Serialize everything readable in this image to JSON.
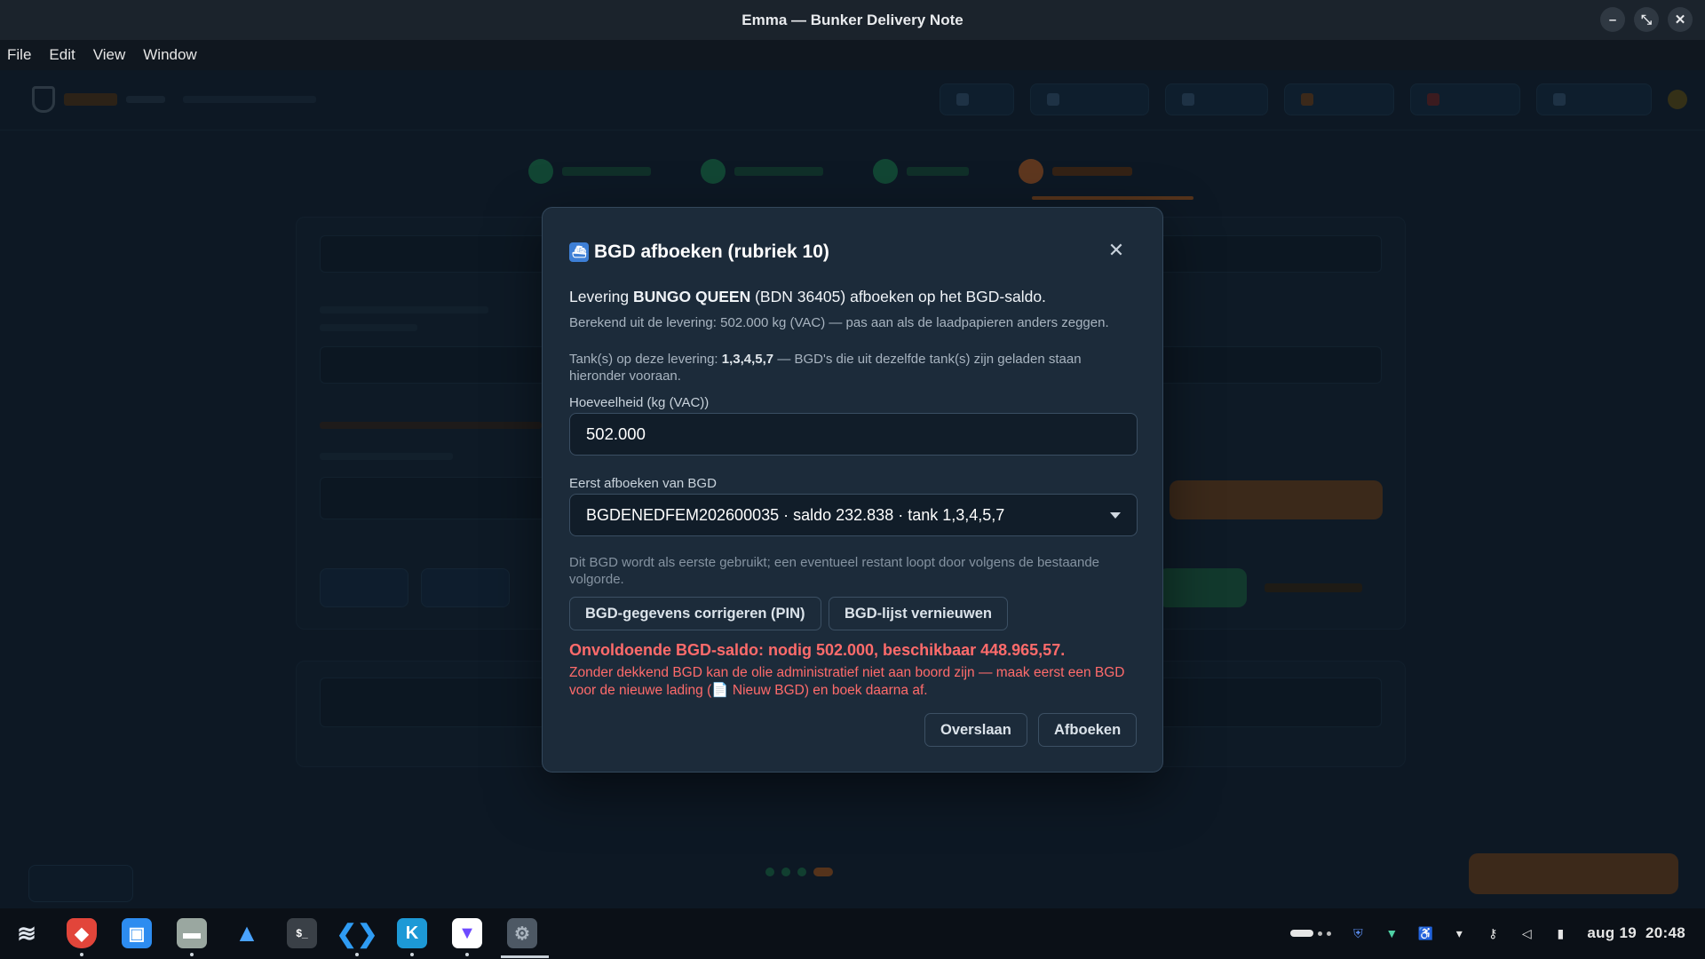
{
  "window": {
    "title": "Emma — Bunker Delivery Note"
  },
  "menu": [
    "File",
    "Edit",
    "View",
    "Window"
  ],
  "modal": {
    "title": "BGD afboeken (rubriek 10)",
    "lead_prefix": "Levering ",
    "lead_vessel": "BUNGO QUEEN",
    "lead_suffix": " (BDN 36405) afboeken op het BGD-saldo.",
    "note_calc": "Berekend uit de levering: 502.000 kg (VAC) — pas aan als de laadpapieren anders zeggen.",
    "note_tanks_prefix": "Tank(s) op deze levering: ",
    "note_tanks_value": "1,3,4,5,7",
    "note_tanks_suffix": " — BGD's die uit dezelfde tank(s) zijn geladen staan hieronder vooraan.",
    "quantity_label": "Hoeveelheid (kg (VAC))",
    "quantity_value": "502.000",
    "bgd_label": "Eerst afboeken van BGD",
    "bgd_selected": "BGDENEDFEM202600035 · saldo 232.838 · tank 1,3,4,5,7",
    "bgd_help": "Dit BGD wordt als eerste gebruikt; een eventueel restant loopt door volgens de bestaande volgorde.",
    "btn_correct": "BGD-gegevens corrigeren (PIN)",
    "btn_refresh": "BGD-lijst vernieuwen",
    "error_main": "Onvoldoende BGD-saldo: nodig 502.000, beschikbaar 448.965,57.",
    "error_detail": "Zonder dekkend BGD kan de olie administratief niet aan boord zijn — maak eerst een BGD voor de nieuwe lading (📄 Nieuw BGD) en boek daarna af.",
    "btn_skip": "Overslaan",
    "btn_book": "Afboeken"
  },
  "taskbar": {
    "apps": [
      "zorin-menu",
      "brave-browser",
      "software-store",
      "files",
      "arch-app",
      "terminal",
      "vscode",
      "kate",
      "proton-vpn",
      "settings"
    ],
    "date": "aug 19",
    "time": "20:48"
  },
  "colors": {
    "accent_orange": "#c7692a",
    "success_green": "#1f8a5a",
    "error_red": "#ff6b6b",
    "modal_bg": "#1c2b3a"
  }
}
